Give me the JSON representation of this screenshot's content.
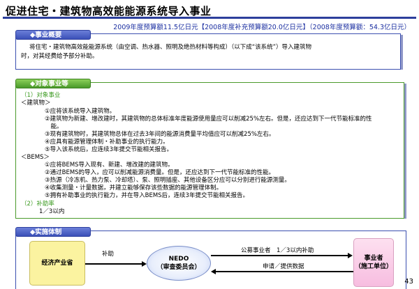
{
  "page": {
    "title": "促进住宅・建筑物高效能能源系统导入事业",
    "budget": "2009年度预算额11.5亿日元【2008年度补充预算额20.0亿日元】（2008年度预算额：54.3亿日元）",
    "page_number": "43"
  },
  "overview": {
    "header": "◆事业概要",
    "line1": "将住宅・建筑物高效能能源系统（由空调、热水器、照明及绝热材料等构成）（以下成“该系统”）导入建筑物",
    "line2": "时，对其经费给予部分补助。"
  },
  "target": {
    "header": "◆对象事业等",
    "sub1": "（1）对象事业",
    "group1": "＜建筑物＞",
    "g1_items": [
      "①应将该系统导入建筑物。",
      "②建筑物为新建、增改建时，其建筑物的总体标准年度能源使用量应可以削减25%左右。但是，还应达到下一代节能标准的性",
      "　能。",
      "③现有建筑物时，其建筑物总体在过去3年间的能源消费量平均值应可以削减25%左右。",
      "④应具有能源管理体制・补助事业的执行能力。",
      "⑤导入该系统后，应连续3年提交节能相关报告。"
    ],
    "group2": "＜BEMS＞",
    "g2_items": [
      "①应将BEMS导入现有、新建、增改建的建筑物。",
      "②通过BEMS的导入，应可以削减能源消费量。但是，还应达到下一代节能标准的性能。",
      "③热源（冷冻机、热力泵、冷却塔）、泵、照明插座、其他设备区分应可以分别进行能源测量。",
      "④收集测量・计量数据，并建立能够保存该些数据的能源管理体制。",
      "⑤拥有补助事业的执行能力，并在导入BEMS后，连续3年提交节能相关报告。"
    ],
    "sub2": "（2）补助率",
    "rate": "1／3以内"
  },
  "implementation": {
    "header": "◆实施体制",
    "ministry": "经济产业省",
    "nedo_line1": "NEDO",
    "nedo_line2": "（审查委员会）",
    "operator_line1": "事业者",
    "operator_line2": "（施工单位）",
    "arrow_subsidy": "补助",
    "arrow_public": "公募事业者　1／3以内补助",
    "arrow_apply": "申请／提供数据"
  }
}
